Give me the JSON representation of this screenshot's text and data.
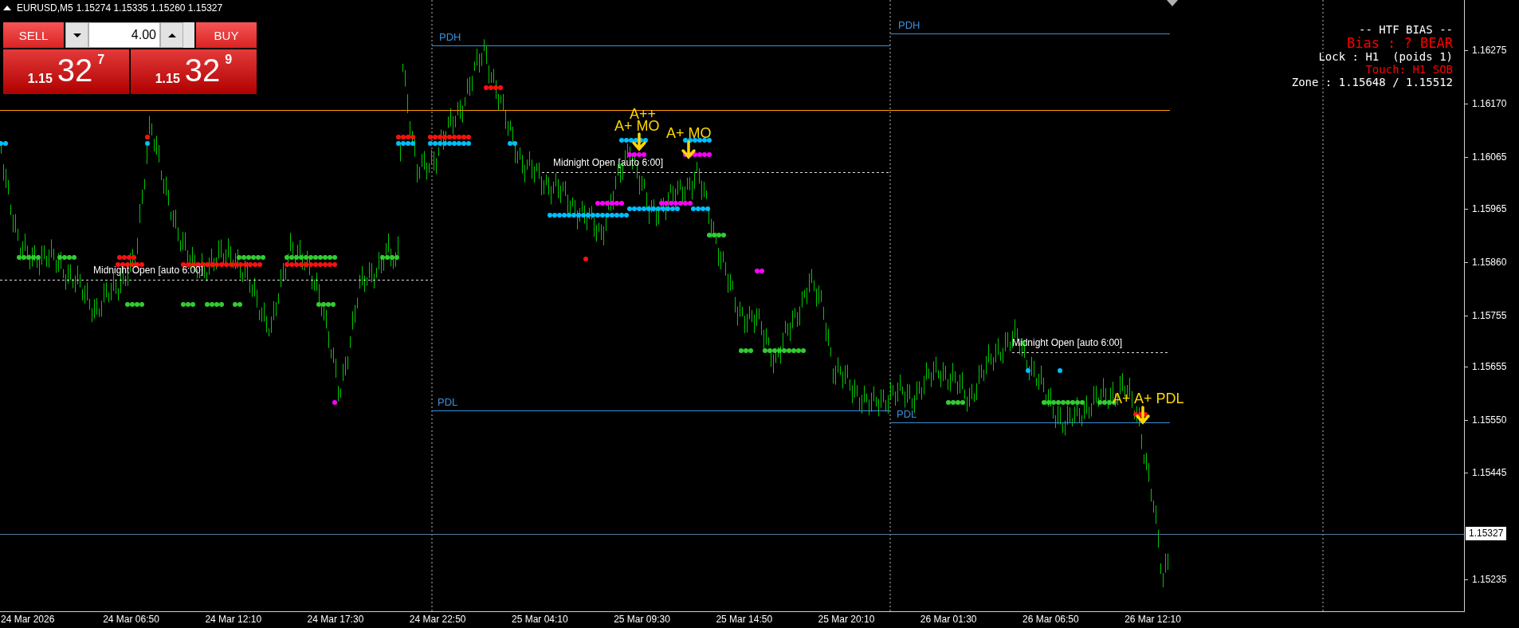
{
  "symbol_bar": {
    "symbol": "EURUSD,M5",
    "quotes": "1.15274 1.15335 1.15260 1.15327"
  },
  "trade_panel": {
    "sell_label": "SELL",
    "buy_label": "BUY",
    "volume": "4.00",
    "sell_price": {
      "prefix": "1.15",
      "big": "32",
      "pip": "7"
    },
    "buy_price": {
      "prefix": "1.15",
      "big": "32",
      "pip": "9"
    }
  },
  "htf_panel": [
    {
      "text": "-- HTF BIAS --",
      "color": "#ffffff"
    },
    {
      "text": "Bias : ? BEAR",
      "color": "#ff0000"
    },
    {
      "text": "Lock : H1  (poids 1)",
      "color": "#ffffff"
    },
    {
      "text": "Touch: H1 SOB",
      "color": "#ff0000"
    },
    {
      "text": "Zone : 1.15648 / 1.15512",
      "color": "#ffffff"
    }
  ],
  "chart_labels": [
    {
      "text": "PDH",
      "kind": "level"
    },
    {
      "text": "PDH",
      "kind": "level"
    },
    {
      "text": "PDL",
      "kind": "level"
    },
    {
      "text": "PDL",
      "kind": "level"
    },
    {
      "text": "Midnight Open [auto 6:00]",
      "kind": "midnight"
    },
    {
      "text": "Midnight Open [auto 6:00]",
      "kind": "midnight"
    },
    {
      "text": "Midnight Open [auto 6:00]",
      "kind": "midnight"
    },
    {
      "text": "A++",
      "kind": "signal"
    },
    {
      "text": "A+ MO",
      "kind": "signal"
    },
    {
      "text": "A+ MO",
      "kind": "signal"
    },
    {
      "text": "A+",
      "kind": "signal"
    },
    {
      "text": "A+ PDL",
      "kind": "signal"
    }
  ],
  "price_axis": {
    "ticks": [
      "1.16275",
      "1.16170",
      "1.16065",
      "1.15965",
      "1.15860",
      "1.15755",
      "1.15655",
      "1.15550",
      "1.15445",
      "1.15235"
    ],
    "current": "1.15327"
  },
  "time_axis": [
    "24 Mar 2026",
    "24 Mar 06:50",
    "24 Mar 12:10",
    "24 Mar 17:30",
    "24 Mar 22:50",
    "25 Mar 04:10",
    "25 Mar 09:30",
    "25 Mar 14:50",
    "25 Mar 20:10",
    "26 Mar 01:30",
    "26 Mar 06:50",
    "26 Mar 12:10"
  ]
}
